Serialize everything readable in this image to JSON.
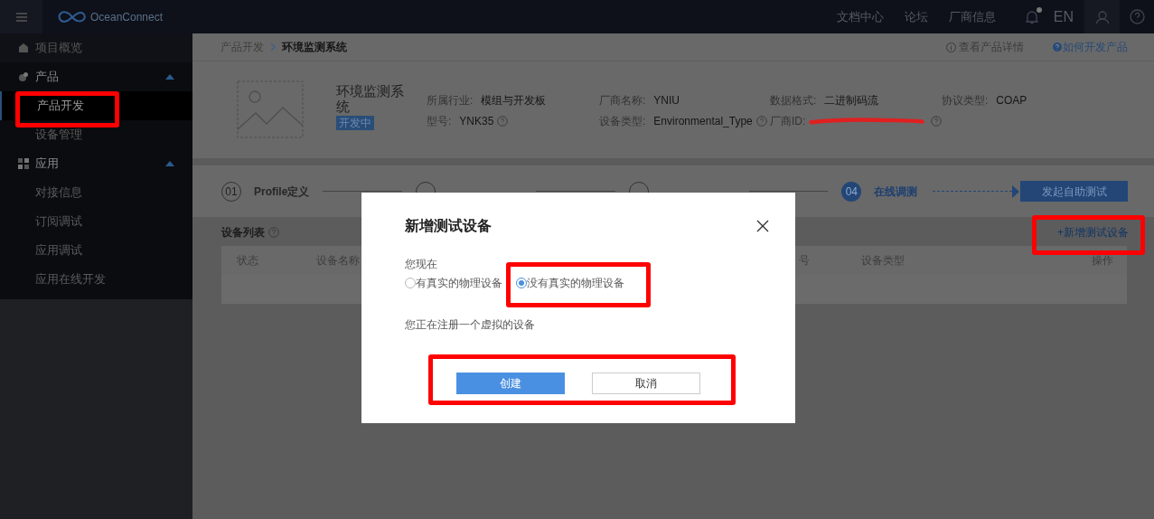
{
  "topbar": {
    "brand": "OceanConnect",
    "links": [
      "文档中心",
      "论坛",
      "厂商信息"
    ],
    "notification_dot": true,
    "language": "EN"
  },
  "sidebar": {
    "groups": [
      {
        "label": "项目概览"
      },
      {
        "label": "产品",
        "expanded": true,
        "children": [
          {
            "label": "产品开发",
            "selected": true
          },
          {
            "label": "设备管理",
            "selected": false
          }
        ]
      },
      {
        "label": "应用",
        "expanded": true,
        "children": [
          {
            "label": "对接信息",
            "selected": false
          },
          {
            "label": "订阅调试",
            "selected": false
          },
          {
            "label": "应用调试",
            "selected": false
          },
          {
            "label": "应用在线开发",
            "selected": false
          }
        ]
      }
    ]
  },
  "breadcrumb": {
    "items": [
      "产品开发",
      "环境监测系统"
    ],
    "links": [
      {
        "kind": "info",
        "label": "查看产品详情"
      },
      {
        "kind": "help",
        "label": "如何开发产品"
      }
    ]
  },
  "product": {
    "name": "环境监测系统",
    "status": "开发中",
    "fields": [
      {
        "label": "所属行业:",
        "value": "模组与开发板",
        "help": false
      },
      {
        "label": "厂商名称:",
        "value": "YNIU",
        "help": false
      },
      {
        "label": "数据格式:",
        "value": "二进制码流",
        "help": false
      },
      {
        "label": "协议类型:",
        "value": "COAP",
        "help": false
      },
      {
        "label": "型号:",
        "value": "YNK35",
        "help": true
      },
      {
        "label": "设备类型:",
        "value": "Environmental_Type",
        "help": true
      },
      {
        "label": "厂商ID:",
        "help": true
      }
    ]
  },
  "steps": {
    "items": [
      {
        "number": "01",
        "label": "Profile定义",
        "selected": false
      },
      {
        "selected": false
      },
      {
        "selected": false
      },
      {
        "number": "04",
        "label": "在线调测",
        "selected": true
      }
    ],
    "action": "发起自助测试"
  },
  "device_list": {
    "title": "设备列表",
    "add_button": "+新增测试设备",
    "columns": [
      "状态",
      "设备名称",
      "号",
      "设备类型",
      "操作"
    ]
  },
  "dialog": {
    "title": "新增测试设备",
    "prompt": "您现在",
    "options": [
      {
        "label": "有真实的物理设备",
        "selected": false
      },
      {
        "label": "没有真实的物理设备",
        "selected": true
      }
    ],
    "note": "您正在注册一个虚拟的设备",
    "buttons": [
      {
        "kind": "primary",
        "label": "创建"
      },
      {
        "kind": "secondary",
        "label": "取消"
      }
    ]
  }
}
